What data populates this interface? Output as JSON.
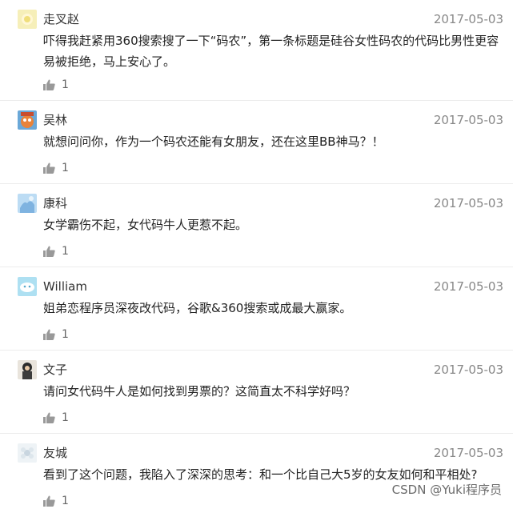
{
  "comments": [
    {
      "user": "走叉赵",
      "date": "2017-05-03",
      "text": "吓得我赶紧用360搜索搜了一下“码农”，第一条标题是硅谷女性码农的代码比男性更容易被拒绝，马上安心了。",
      "likes": "1",
      "avatar": "sun-avatar",
      "color": "#f3e9a8"
    },
    {
      "user": "吴林",
      "date": "2017-05-03",
      "text": "就想问问你，作为一个码农还能有女朋友，还在这里BB神马？！",
      "likes": "1",
      "avatar": "cartoon-avatar",
      "color": "#e8833a"
    },
    {
      "user": "康科",
      "date": "2017-05-03",
      "text": "女学霸伤不起，女代码牛人更惹不起。",
      "likes": "1",
      "avatar": "sky-avatar",
      "color": "#9cc7ea"
    },
    {
      "user": "William",
      "date": "2017-05-03",
      "text": "姐弟恋程序员深夜改代码，谷歌&360搜索或成最大赢家。",
      "likes": "1",
      "avatar": "cloud-avatar",
      "color": "#b9e3f2"
    },
    {
      "user": "文子",
      "date": "2017-05-03",
      "text": "请问女代码牛人是如何找到男票的？这简直太不科学好吗？",
      "likes": "1",
      "avatar": "person-avatar",
      "color": "#2b2b2b"
    },
    {
      "user": "友城",
      "date": "2017-05-03",
      "text": "看到了这个问题，我陷入了深深的思考：和一个比自己大5岁的女友如何和平相处?",
      "likes": "1",
      "avatar": "flower-avatar",
      "color": "#dfe8ef"
    }
  ],
  "watermark": "CSDN @Yuki程序员"
}
